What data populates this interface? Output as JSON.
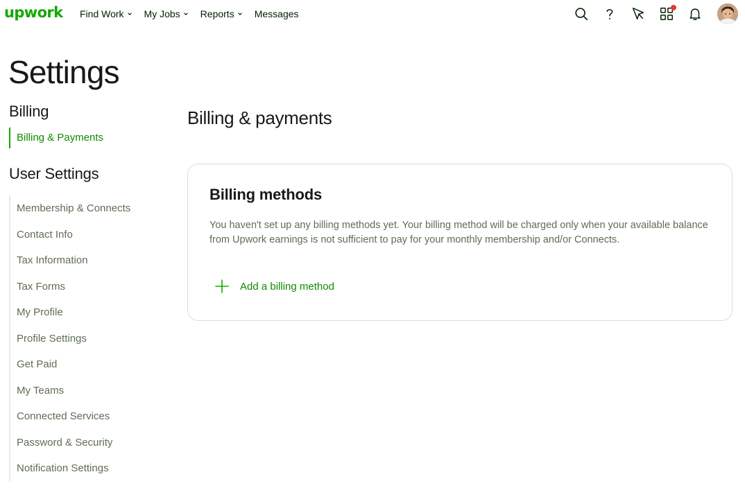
{
  "app": {
    "logo_text": "upwork",
    "brand_color": "#14a800"
  },
  "nav": {
    "items": [
      {
        "label": "Find Work",
        "has_dropdown": true
      },
      {
        "label": "My Jobs",
        "has_dropdown": true
      },
      {
        "label": "Reports",
        "has_dropdown": true
      },
      {
        "label": "Messages",
        "has_dropdown": false
      }
    ],
    "icons": [
      "search-icon",
      "help-icon",
      "direct-contracts-icon",
      "apps-icon",
      "bell-icon",
      "avatar"
    ]
  },
  "page": {
    "title": "Settings"
  },
  "sidebar": {
    "billing_heading": "Billing",
    "billing_items": [
      {
        "label": "Billing & Payments",
        "active": true
      }
    ],
    "user_heading": "User Settings",
    "user_items": [
      {
        "label": "Membership & Connects"
      },
      {
        "label": "Contact Info"
      },
      {
        "label": "Tax Information"
      },
      {
        "label": "Tax Forms"
      },
      {
        "label": "My Profile"
      },
      {
        "label": "Profile Settings"
      },
      {
        "label": "Get Paid"
      },
      {
        "label": "My Teams"
      },
      {
        "label": "Connected Services"
      },
      {
        "label": "Password & Security"
      },
      {
        "label": "Notification Settings"
      }
    ]
  },
  "main": {
    "title": "Billing & payments",
    "card": {
      "title": "Billing methods",
      "text": "You haven't set up any billing methods yet. Your billing method will be charged only when your available balance from Upwork earnings is not sufficient to pay for your monthly membership and/or Connects.",
      "add_label": "Add a billing method"
    }
  }
}
